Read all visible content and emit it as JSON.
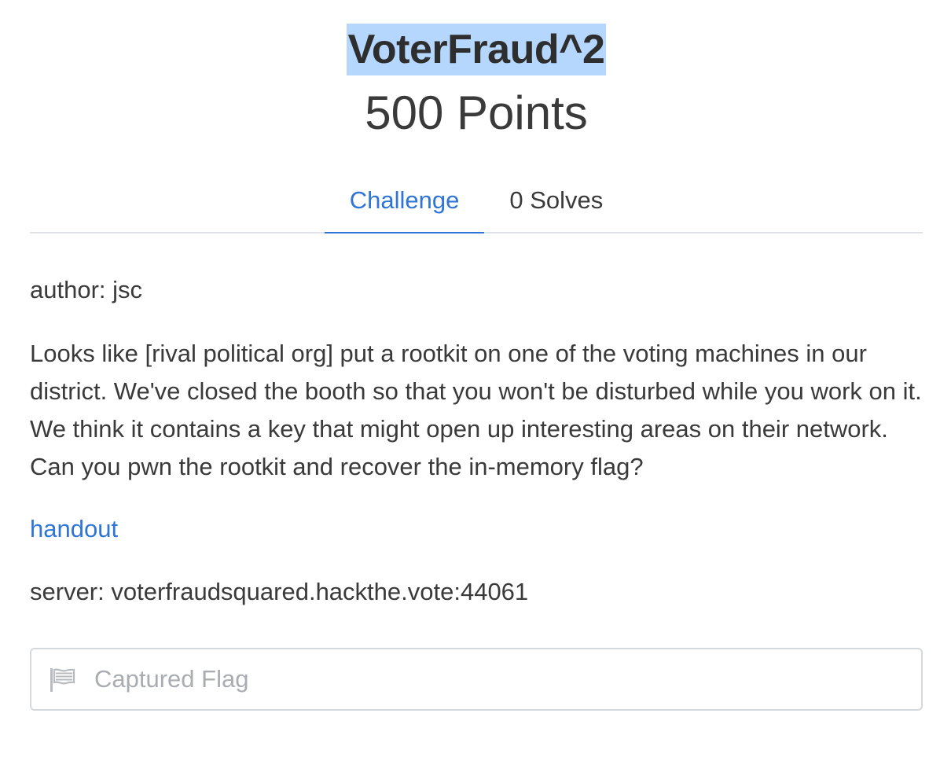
{
  "challenge": {
    "title": "VoterFraud^2",
    "points": "500 Points"
  },
  "tabs": [
    {
      "label": "Challenge",
      "active": true
    },
    {
      "label": "0 Solves",
      "active": false
    }
  ],
  "body": {
    "author": "author: jsc",
    "description": "Looks like [rival political org] put a rootkit on one of the voting machines in our district. We've closed the booth so that you won't be disturbed while you work on it. We think it contains a key that might open up interesting areas on their network. Can you pwn the rootkit and recover the in-memory flag?",
    "handout_label": "handout",
    "server": "server: voterfraudsquared.hackthe.vote:44061"
  },
  "flag_input": {
    "placeholder": "Captured Flag",
    "value": "",
    "icon": "flag-icon"
  },
  "colors": {
    "accent": "#2f75d6",
    "selection_highlight": "#b5d7fd",
    "text": "#3a3a3a",
    "placeholder": "#a9adb2",
    "border": "#d6d9dc"
  }
}
